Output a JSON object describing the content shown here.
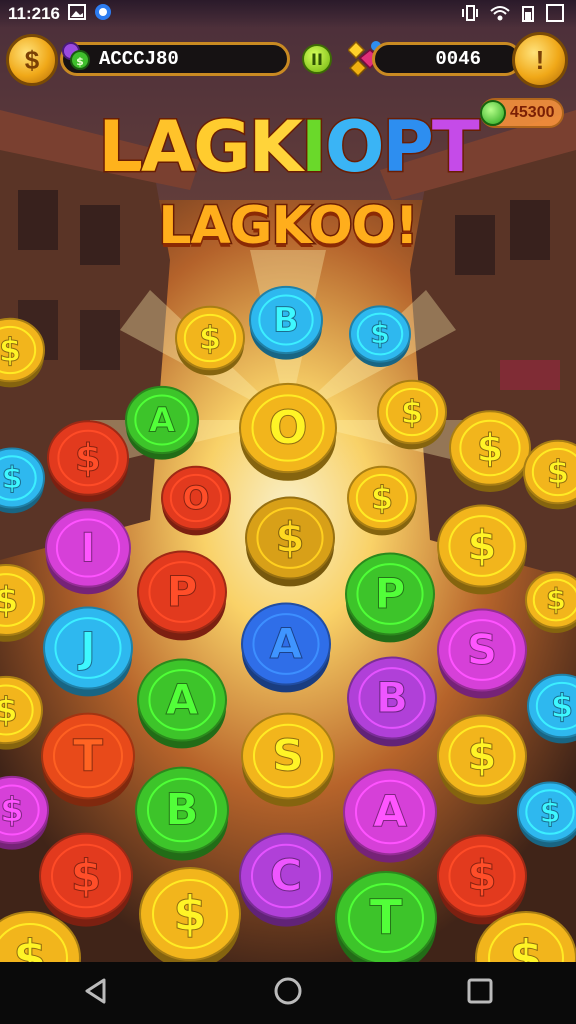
{
  "status_bar": {
    "time": "11:216"
  },
  "hud": {
    "left_coin_symbol": "$",
    "account_code": "ACCCJ80",
    "pause_symbol": "II",
    "score": "0046",
    "right_coin_symbol": "!",
    "gem_badge": "45300"
  },
  "title": {
    "line1_letters": [
      "L",
      "A",
      "G",
      "K",
      "I",
      "O",
      "P",
      "T"
    ],
    "line1_colors": [
      "#ffb21c",
      "#ffc32a",
      "#ffcc2e",
      "#ffd43a",
      "#6ad92a",
      "#3ab4f5",
      "#2d8ef0",
      "#c54be8"
    ],
    "line2": "LAGKOO!"
  },
  "coins": [
    {
      "color": "#f2b51c",
      "symbol": "$"
    },
    {
      "color": "#2eb8ef",
      "symbol": "B"
    },
    {
      "color": "#2eb8ef",
      "symbol": "$"
    },
    {
      "color": "#f2b51c",
      "symbol": "$"
    },
    {
      "color": "#3dc42a",
      "symbol": "A"
    },
    {
      "color": "#f2b51c",
      "symbol": "O"
    },
    {
      "color": "#f2b51c",
      "symbol": "$"
    },
    {
      "color": "#e23a1e",
      "symbol": "$"
    },
    {
      "color": "#f2b51c",
      "symbol": "$"
    },
    {
      "color": "#2eb8ef",
      "symbol": "$"
    },
    {
      "color": "#e23a1e",
      "symbol": "O"
    },
    {
      "color": "#d8a018",
      "symbol": "$"
    },
    {
      "color": "#f2b51c",
      "symbol": "$"
    },
    {
      "color": "#f2b51c",
      "symbol": "$"
    },
    {
      "color": "#d640d8",
      "symbol": "I"
    },
    {
      "color": "#e23a1e",
      "symbol": "P"
    },
    {
      "color": "#3dc42a",
      "symbol": "P"
    },
    {
      "color": "#f2b51c",
      "symbol": "$"
    },
    {
      "color": "#f2b51c",
      "symbol": "$"
    },
    {
      "color": "#2eb8ef",
      "symbol": "J"
    },
    {
      "color": "#2f6ee8",
      "symbol": "A"
    },
    {
      "color": "#d640d8",
      "symbol": "S"
    },
    {
      "color": "#f2b51c",
      "symbol": "$"
    },
    {
      "color": "#3dc42a",
      "symbol": "A"
    },
    {
      "color": "#b040d8",
      "symbol": "B"
    },
    {
      "color": "#2eb8ef",
      "symbol": "$"
    },
    {
      "color": "#f2b51c",
      "symbol": "$"
    },
    {
      "color": "#e84a1a",
      "symbol": "T"
    },
    {
      "color": "#f2b51c",
      "symbol": "S"
    },
    {
      "color": "#f2b51c",
      "symbol": "$"
    },
    {
      "color": "#d640d8",
      "symbol": "$"
    },
    {
      "color": "#3dc42a",
      "symbol": "B"
    },
    {
      "color": "#d640d8",
      "symbol": "A"
    },
    {
      "color": "#2eb8ef",
      "symbol": "$"
    },
    {
      "color": "#e23a1e",
      "symbol": "$"
    },
    {
      "color": "#f2b51c",
      "symbol": "$"
    },
    {
      "color": "#b040d8",
      "symbol": "C"
    },
    {
      "color": "#e23a1e",
      "symbol": "$"
    },
    {
      "color": "#3dc42a",
      "symbol": "T"
    },
    {
      "color": "#f2b51c",
      "symbol": "$"
    },
    {
      "color": "#f2b51c",
      "symbol": "$"
    }
  ],
  "nav": {
    "back": "back-icon",
    "home": "home-icon",
    "recents": "recents-icon"
  }
}
